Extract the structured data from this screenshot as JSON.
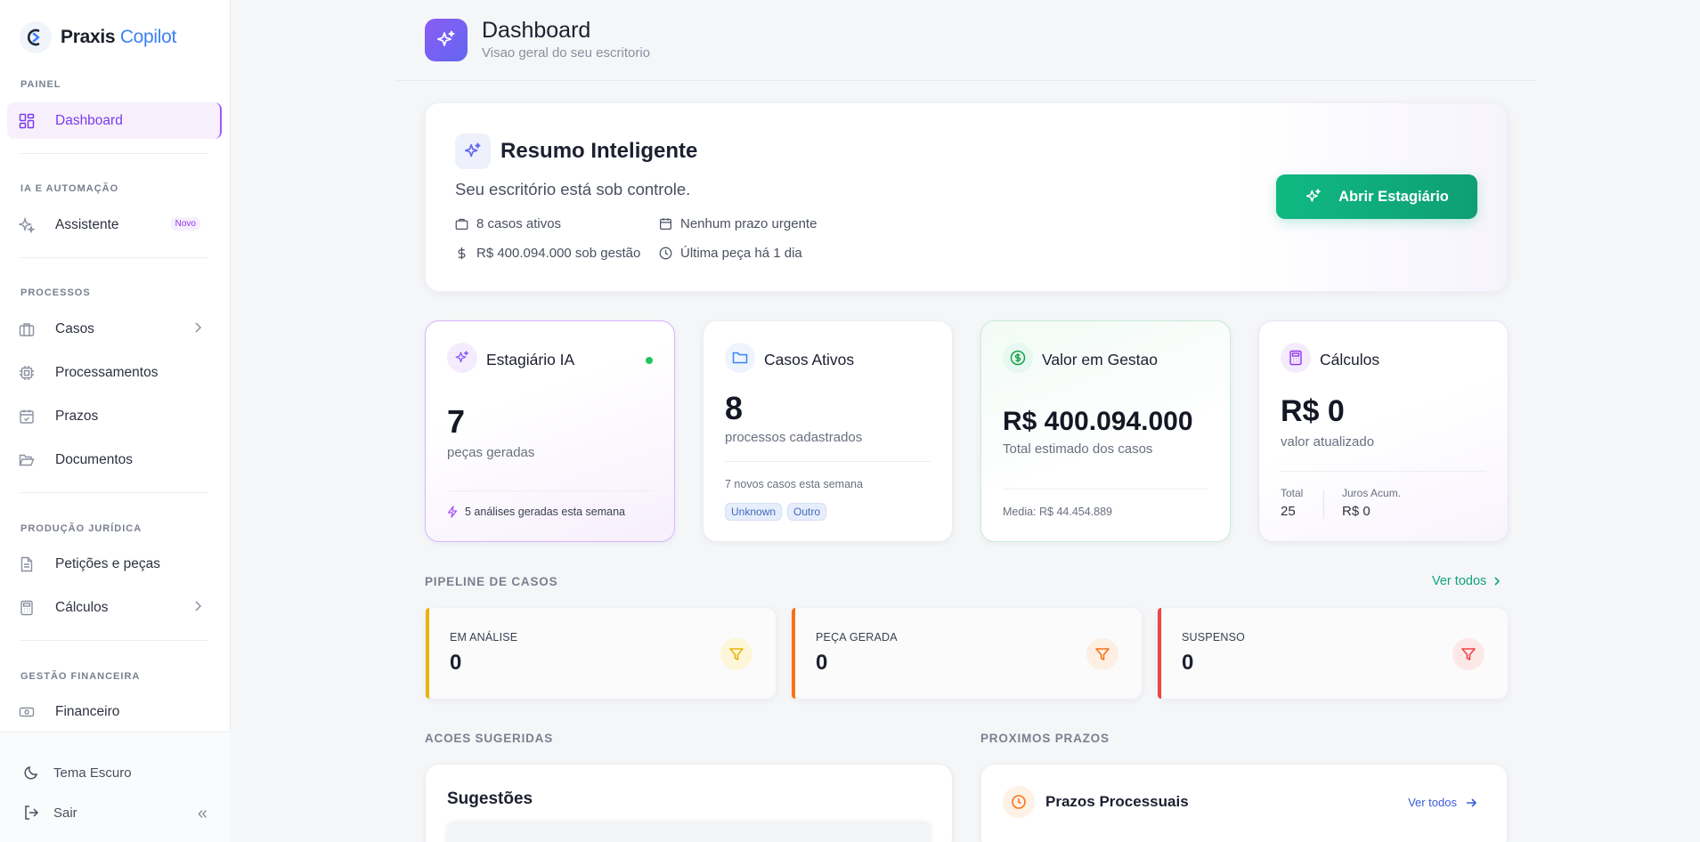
{
  "brand": {
    "name": "Praxis",
    "name_accent": "Copilot"
  },
  "sidebar": {
    "sections": {
      "painel": "PAINEL",
      "ia": "IA E AUTOMAÇÃO",
      "processos": "PROCESSOS",
      "producao": "PRODUÇÃO JURÍDICA",
      "gestao": "GESTÃO FINANCEIRA"
    },
    "items": {
      "dashboard": "Dashboard",
      "assistente": "Assistente",
      "assistente_badge": "Novo",
      "casos": "Casos",
      "processamentos": "Processamentos",
      "prazos": "Prazos",
      "documentos": "Documentos",
      "peticoes": "Petições e peças",
      "calculos": "Cálculos",
      "financeiro": "Financeiro"
    },
    "footer": {
      "theme": "Tema Escuro",
      "logout": "Sair",
      "collapse": "«"
    }
  },
  "header": {
    "title": "Dashboard",
    "subtitle": "Visao geral do seu escritorio"
  },
  "summary": {
    "title": "Resumo Inteligente",
    "line": "Seu escritório está sob controle.",
    "stats": {
      "casos": "8 casos ativos",
      "valor": "R$ 400.094.000 sob gestão",
      "prazo": "Nenhum prazo urgente",
      "peca": "Última peça há 1 dia"
    },
    "button": "Abrir Estagiário"
  },
  "cards": {
    "estagiario": {
      "title": "Estagiário IA",
      "value": "7",
      "sub": "peças geradas",
      "foot": "5 análises geradas esta semana"
    },
    "casos": {
      "title": "Casos Ativos",
      "value": "8",
      "sub": "processos cadastrados",
      "foot": "7 novos casos esta semana",
      "tags": [
        "Unknown",
        "Outro"
      ]
    },
    "valor": {
      "title": "Valor em Gestao",
      "value": "R$ 400.094.000",
      "sub": "Total estimado dos casos",
      "foot": "Media: R$ 44.454.889"
    },
    "calculos": {
      "title": "Cálculos",
      "value": "R$ 0",
      "sub": "valor atualizado",
      "total_label": "Total",
      "total_value": "25",
      "juros_label": "Juros Acum.",
      "juros_value": "R$ 0"
    }
  },
  "pipeline": {
    "label": "PIPELINE DE CASOS",
    "see_all": "Ver todos",
    "stages": [
      {
        "label": "EM ANÁLISE",
        "value": "0",
        "color": "#eab308"
      },
      {
        "label": "PEÇA GERADA",
        "value": "0",
        "color": "#f97316"
      },
      {
        "label": "SUSPENSO",
        "value": "0",
        "color": "#ef4444"
      }
    ]
  },
  "acoes": {
    "label": "ACOES SUGERIDAS",
    "card_title": "Sugestões"
  },
  "prazos": {
    "label": "PROXIMOS PRAZOS",
    "card_title": "Prazos Processuais",
    "see_all": "Ver todos"
  }
}
